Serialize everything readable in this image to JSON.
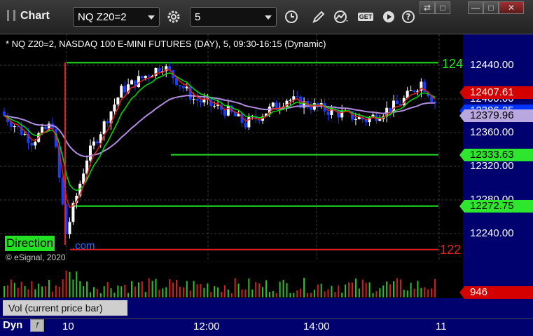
{
  "window": {
    "title": "Chart",
    "symbol_value": "NQ Z20=2",
    "interval_value": "5",
    "icons": [
      "settings-gear-icon",
      "clock-icon",
      "pencil-icon",
      "study-icon",
      "get-data-icon",
      "play-icon",
      "help-icon"
    ],
    "window_buttons": [
      "restore",
      "minimize",
      "maximize",
      "close"
    ]
  },
  "chart": {
    "header": "* NQ Z20=2, NASDAQ 100 E-MINI FUTURES (DAY), 5, 09:30-16:15 (Dynamic)",
    "copyright": "© eSignal, 2020",
    "watermark_left": "Direction",
    "watermark_right": ".com",
    "right_line_label_top": "124",
    "right_line_label_bottom": "122",
    "y_ticks": [
      "12440.00",
      "12400.00",
      "12360.00",
      "12320.00",
      "12280.00",
      "12240.00"
    ],
    "price_tags": [
      {
        "label": "12407.61",
        "bg": "#d40000",
        "fg": "#ffffff",
        "y": 12407.61
      },
      {
        "label": "12386.25",
        "bg": "#0033ff",
        "fg": "#ffffff",
        "y": 12386.25
      },
      {
        "label": "12379.96",
        "bg": "#b9a8e0",
        "fg": "#000000",
        "y": 12379.96
      },
      {
        "label": "12333.63",
        "bg": "#2ee62e",
        "fg": "#000000",
        "y": 12333.63
      },
      {
        "label": "12272.75",
        "bg": "#2ee62e",
        "fg": "#000000",
        "y": 12272.75
      }
    ],
    "colors": {
      "up": "#ffffff",
      "down": "#1a3cff",
      "ema_fast": "#00dd00",
      "ema_slow": "#b08be0",
      "red": "#e02020",
      "level": "#22e022"
    }
  },
  "volume": {
    "label": "Vol (current price bar)",
    "value_tag": "946",
    "close_glyph": "x"
  },
  "timeaxis": {
    "mode": "Dyn",
    "f_button": "f",
    "labels": [
      "10",
      "12:00",
      "14:00",
      "11"
    ]
  },
  "chart_data": {
    "type": "candlestick",
    "title": "NQ Z20=2, NASDAQ 100 E-MINI FUTURES (DAY), 5, 09:30-16:15 (Dynamic)",
    "xlabel": "",
    "ylabel": "",
    "ylim": [
      12220,
      12460
    ],
    "x_tick_labels": [
      "10",
      "12:00",
      "14:00",
      "11"
    ],
    "horizontal_levels": [
      {
        "value": 12443,
        "color": "green"
      },
      {
        "value": 12333.63,
        "color": "green"
      },
      {
        "value": 12272.75,
        "color": "green"
      },
      {
        "value": 12221,
        "color": "red"
      }
    ],
    "last_values": {
      "red_line": 12407.61,
      "close": 12386.25,
      "slow_average": 12379.96,
      "volume": 946
    }
  }
}
